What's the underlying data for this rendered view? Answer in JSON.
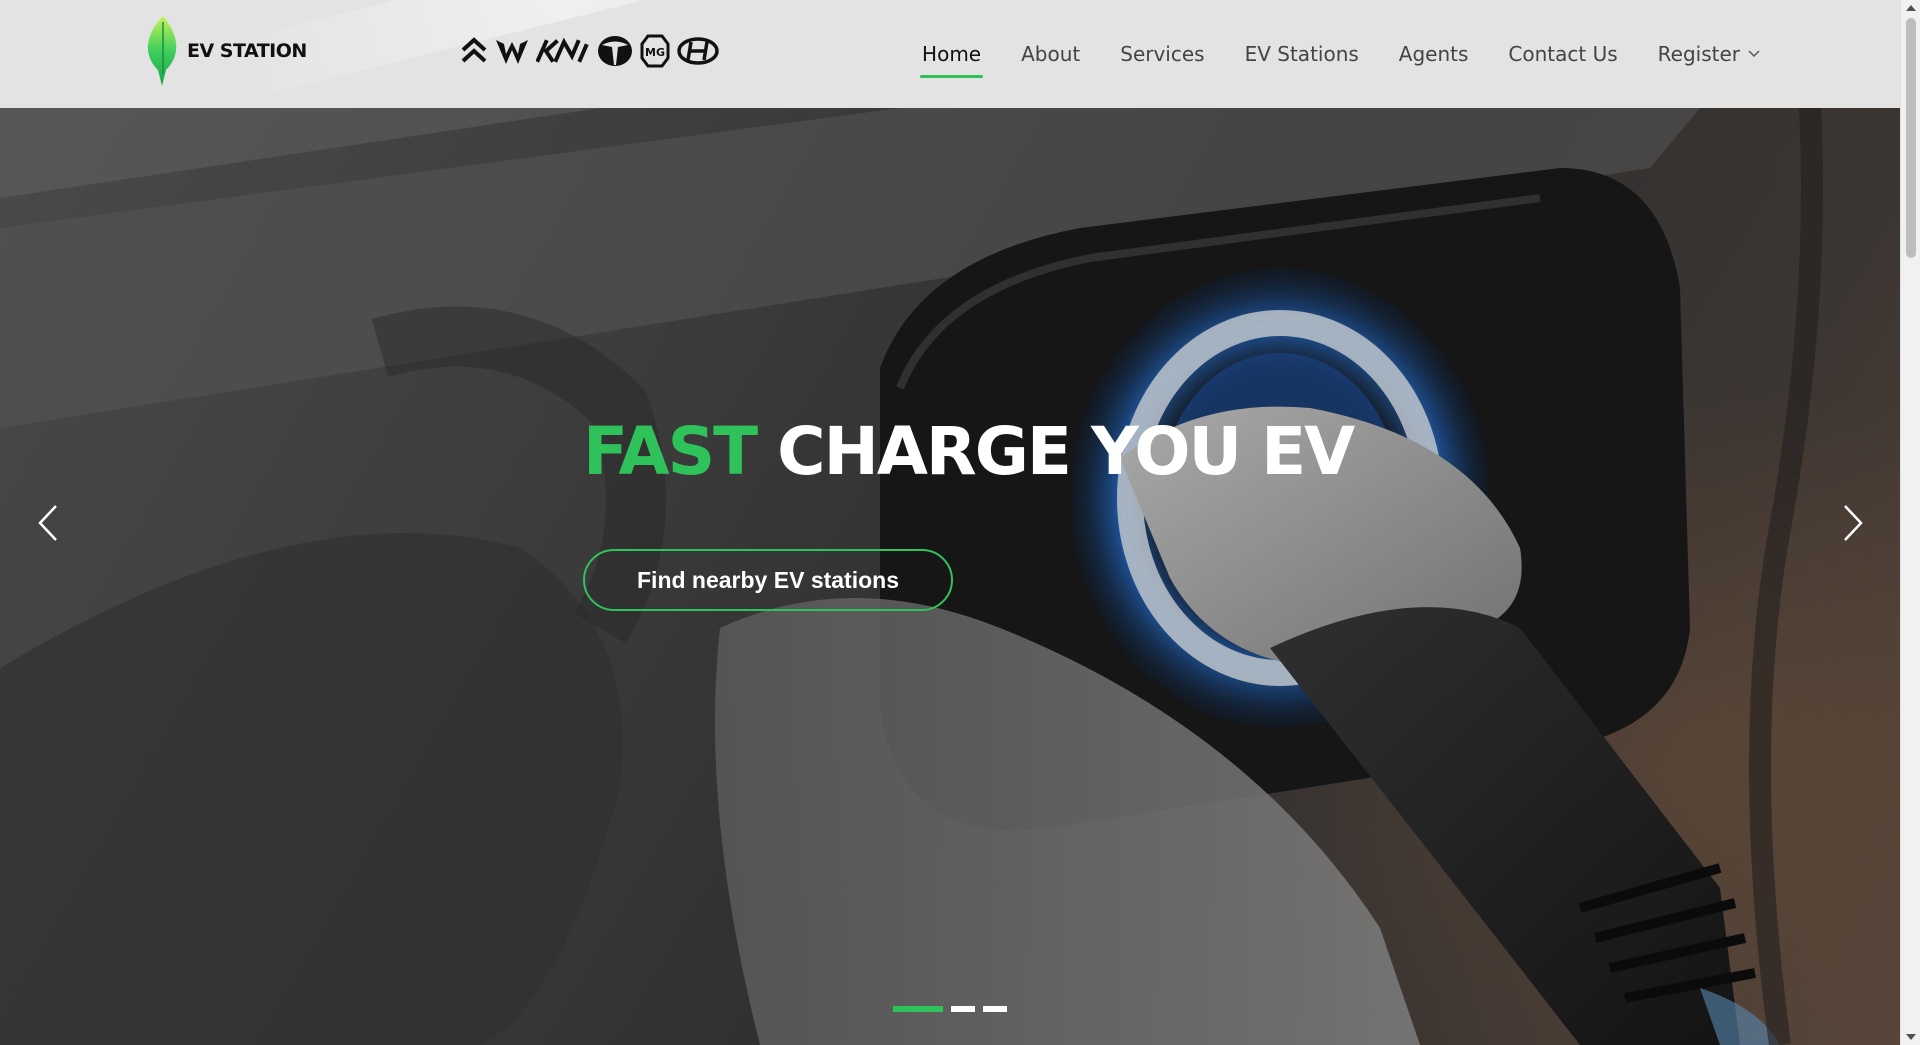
{
  "logo": {
    "text": "EV STATION",
    "accent_color": "#2fc25b"
  },
  "brands": [
    {
      "icon": "citroen-logo-icon"
    },
    {
      "icon": "wuling-logo-icon"
    },
    {
      "icon": "kia-logo-icon"
    },
    {
      "icon": "tata-logo-icon"
    },
    {
      "icon": "mg-logo-icon"
    },
    {
      "icon": "hyundai-logo-icon"
    }
  ],
  "nav": {
    "items": [
      {
        "label": "Home",
        "active": true
      },
      {
        "label": "About"
      },
      {
        "label": "Services"
      },
      {
        "label": "EV Stations"
      },
      {
        "label": "Agents"
      },
      {
        "label": "Contact Us"
      },
      {
        "label": "Register",
        "dropdown": true
      }
    ],
    "active_color": "#2fbf5a"
  },
  "hero": {
    "title_accent": "FAST",
    "title_rest": "CHARGE YOU EV",
    "cta_label": "Find nearby EV stations",
    "prev_icon": "chevron-left-icon",
    "next_icon": "chevron-right-icon",
    "slides_total": 3,
    "active_slide": 1,
    "accent_color": "#2fc25b"
  }
}
